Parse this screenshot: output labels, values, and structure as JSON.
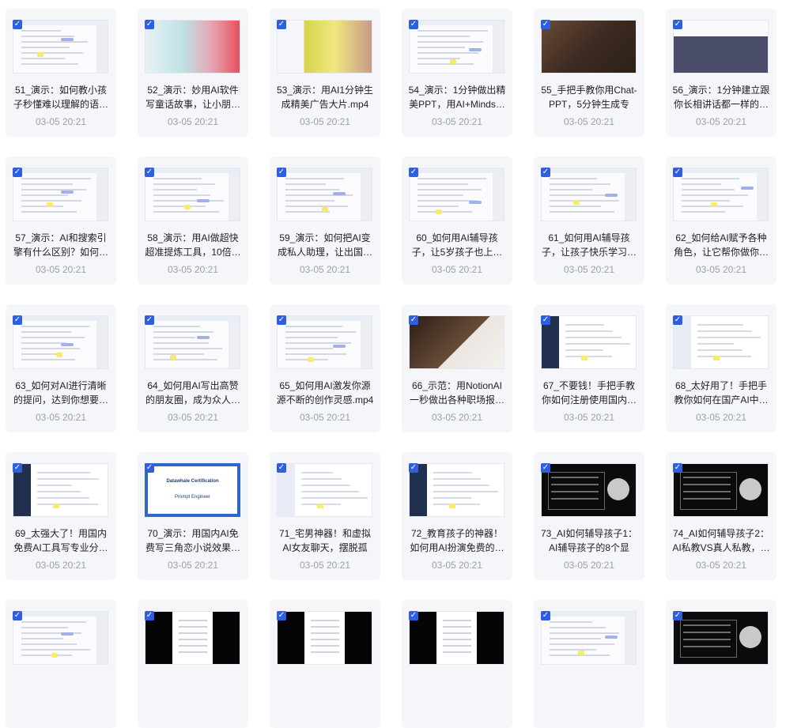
{
  "items": [
    {
      "title": "51_演示：如何教小孩子秒懂难以理解的语…",
      "date": "03-05 20:21",
      "thumb": "doc"
    },
    {
      "title": "52_演示：妙用AI软件写童话故事，让小朋…",
      "date": "03-05 20:21",
      "thumb": "photo1"
    },
    {
      "title": "53_演示：用AI1分钟生成精美广告大片.mp4",
      "date": "03-05 20:21",
      "thumb": "photo2"
    },
    {
      "title": "54_演示：1分钟做出精美PPT，用AI+Minds…",
      "date": "03-05 20:21",
      "thumb": "doc"
    },
    {
      "title": "55_手把手教你用Chat-PPT，5分钟生成专业…",
      "date": "03-05 20:21",
      "thumb": "photo3"
    },
    {
      "title": "56_演示：1分钟建立跟你长相讲话都一样的…",
      "date": "03-05 20:21",
      "thumb": "photo4"
    },
    {
      "title": "57_演示：AI和搜索引擎有什么区别？如何…",
      "date": "03-05 20:21",
      "thumb": "doc"
    },
    {
      "title": "58_演示：用AI做超快超准提炼工具，10倍…",
      "date": "03-05 20:21",
      "thumb": "doc"
    },
    {
      "title": "59_演示：如何把AI变成私人助理，让出国…",
      "date": "03-05 20:21",
      "thumb": "doc"
    },
    {
      "title": "60_如何用AI辅导孩子，让5岁孩子也上…",
      "date": "03-05 20:21",
      "thumb": "doc"
    },
    {
      "title": "61_如何用AI辅导孩子，让孩子快乐学习…",
      "date": "03-05 20:21",
      "thumb": "doc"
    },
    {
      "title": "62_如何给AI赋予各种角色，让它帮你做你…",
      "date": "03-05 20:21",
      "thumb": "doc"
    },
    {
      "title": "63_如何对AI进行清晰的提问，达到你想要…",
      "date": "03-05 20:21",
      "thumb": "doc"
    },
    {
      "title": "64_如何用AI写出高赞的朋友圈，成为众人…",
      "date": "03-05 20:21",
      "thumb": "doc"
    },
    {
      "title": "65_如何用AI激发你源源不断的创作灵感.mp4",
      "date": "03-05 20:21",
      "thumb": "doc"
    },
    {
      "title": "66_示范：用NotionAI一秒做出各种职场报…",
      "date": "03-05 20:21",
      "thumb": "photo5"
    },
    {
      "title": "67_不要钱！手把手教你如何注册使用国内…",
      "date": "03-05 20:21",
      "thumb": "side"
    },
    {
      "title": "68_太好用了！手把手教你如何在国产AI中…",
      "date": "03-05 20:21",
      "thumb": "side"
    },
    {
      "title": "69_太强大了！用国内免费AI工具写专业分…",
      "date": "03-05 20:21",
      "thumb": "side"
    },
    {
      "title": "70_演示：用国内AI免费写三角恋小说效果…",
      "date": "03-05 20:21",
      "thumb": "cert"
    },
    {
      "title": "71_宅男神器！和虚拟AI女友聊天，摆脱孤独…",
      "date": "03-05 20:21",
      "thumb": "side"
    },
    {
      "title": "72_教育孩子的神器！如何用AI扮演免费的…",
      "date": "03-05 20:21",
      "thumb": "side"
    },
    {
      "title": "73_AI如何辅导孩子1：AI辅导孩子的8个显著…",
      "date": "03-05 20:21",
      "thumb": "dark"
    },
    {
      "title": "74_AI如何辅导孩子2：AI私教VS真人私教，…",
      "date": "03-05 20:21",
      "thumb": "dark"
    },
    {
      "title": "",
      "date": "",
      "thumb": "doc"
    },
    {
      "title": "",
      "date": "",
      "thumb": "page"
    },
    {
      "title": "",
      "date": "",
      "thumb": "page"
    },
    {
      "title": "",
      "date": "",
      "thumb": "page"
    },
    {
      "title": "",
      "date": "",
      "thumb": "doc"
    },
    {
      "title": "",
      "date": "",
      "thumb": "dark"
    }
  ],
  "cert_text": {
    "line1": "Datawhale Certification",
    "line2": "Prompt Engineer"
  },
  "checkbox_glyph": "✓",
  "colors": {
    "accent": "#2f5fe0",
    "card_bg": "#f5f6fa",
    "date": "#9aa0ab"
  }
}
